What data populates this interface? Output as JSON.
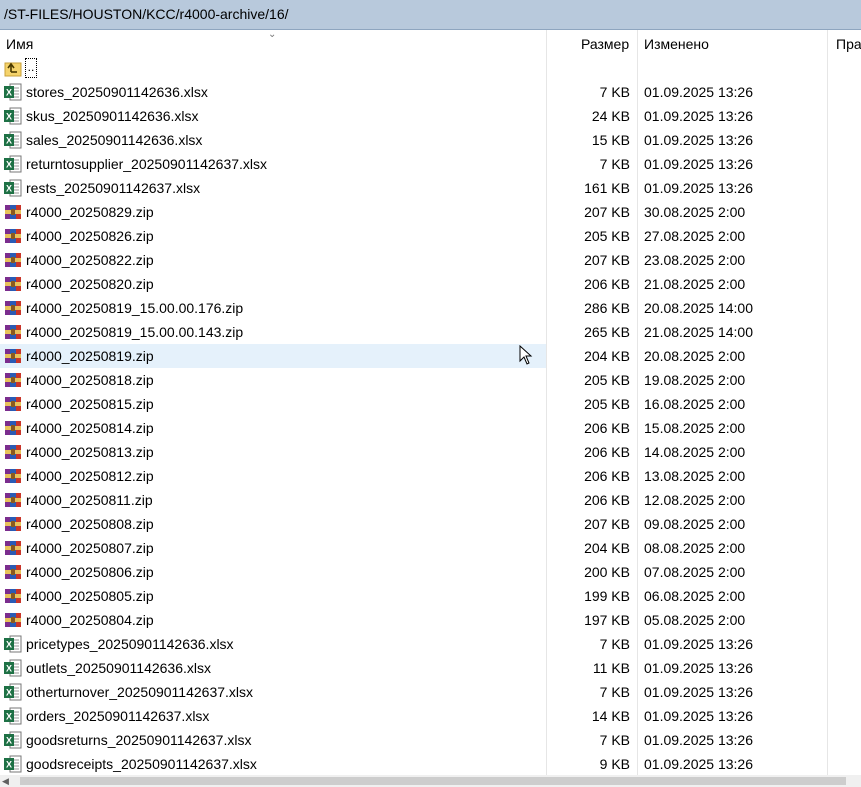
{
  "path": "/ST-FILES/HOUSTON/KCC/r4000-archive/16/",
  "columns": {
    "name": "Имя",
    "size": "Размер",
    "modified": "Изменено",
    "rights": "Пра"
  },
  "parent_label": "..",
  "files": [
    {
      "name": "stores_20250901142636.xlsx",
      "size": "7 KB",
      "date": "01.09.2025 13:26",
      "type": "xlsx"
    },
    {
      "name": "skus_20250901142636.xlsx",
      "size": "24 KB",
      "date": "01.09.2025 13:26",
      "type": "xlsx"
    },
    {
      "name": "sales_20250901142636.xlsx",
      "size": "15 KB",
      "date": "01.09.2025 13:26",
      "type": "xlsx"
    },
    {
      "name": "returntosupplier_20250901142637.xlsx",
      "size": "7 KB",
      "date": "01.09.2025 13:26",
      "type": "xlsx"
    },
    {
      "name": "rests_20250901142637.xlsx",
      "size": "161 KB",
      "date": "01.09.2025 13:26",
      "type": "xlsx"
    },
    {
      "name": "r4000_20250829.zip",
      "size": "207 KB",
      "date": "30.08.2025 2:00",
      "type": "zip"
    },
    {
      "name": "r4000_20250826.zip",
      "size": "205 KB",
      "date": "27.08.2025 2:00",
      "type": "zip"
    },
    {
      "name": "r4000_20250822.zip",
      "size": "207 KB",
      "date": "23.08.2025 2:00",
      "type": "zip"
    },
    {
      "name": "r4000_20250820.zip",
      "size": "206 KB",
      "date": "21.08.2025 2:00",
      "type": "zip"
    },
    {
      "name": "r4000_20250819_15.00.00.176.zip",
      "size": "286 KB",
      "date": "20.08.2025 14:00",
      "type": "zip"
    },
    {
      "name": "r4000_20250819_15.00.00.143.zip",
      "size": "265 KB",
      "date": "21.08.2025 14:00",
      "type": "zip"
    },
    {
      "name": "r4000_20250819.zip",
      "size": "204 KB",
      "date": "20.08.2025 2:00",
      "type": "zip",
      "hover": true
    },
    {
      "name": "r4000_20250818.zip",
      "size": "205 KB",
      "date": "19.08.2025 2:00",
      "type": "zip"
    },
    {
      "name": "r4000_20250815.zip",
      "size": "205 KB",
      "date": "16.08.2025 2:00",
      "type": "zip"
    },
    {
      "name": "r4000_20250814.zip",
      "size": "206 KB",
      "date": "15.08.2025 2:00",
      "type": "zip"
    },
    {
      "name": "r4000_20250813.zip",
      "size": "206 KB",
      "date": "14.08.2025 2:00",
      "type": "zip"
    },
    {
      "name": "r4000_20250812.zip",
      "size": "206 KB",
      "date": "13.08.2025 2:00",
      "type": "zip"
    },
    {
      "name": "r4000_20250811.zip",
      "size": "206 KB",
      "date": "12.08.2025 2:00",
      "type": "zip"
    },
    {
      "name": "r4000_20250808.zip",
      "size": "207 KB",
      "date": "09.08.2025 2:00",
      "type": "zip"
    },
    {
      "name": "r4000_20250807.zip",
      "size": "204 KB",
      "date": "08.08.2025 2:00",
      "type": "zip"
    },
    {
      "name": "r4000_20250806.zip",
      "size": "200 KB",
      "date": "07.08.2025 2:00",
      "type": "zip"
    },
    {
      "name": "r4000_20250805.zip",
      "size": "199 KB",
      "date": "06.08.2025 2:00",
      "type": "zip"
    },
    {
      "name": "r4000_20250804.zip",
      "size": "197 KB",
      "date": "05.08.2025 2:00",
      "type": "zip"
    },
    {
      "name": "pricetypes_20250901142636.xlsx",
      "size": "7 KB",
      "date": "01.09.2025 13:26",
      "type": "xlsx"
    },
    {
      "name": "outlets_20250901142636.xlsx",
      "size": "11 KB",
      "date": "01.09.2025 13:26",
      "type": "xlsx"
    },
    {
      "name": "otherturnover_20250901142637.xlsx",
      "size": "7 KB",
      "date": "01.09.2025 13:26",
      "type": "xlsx"
    },
    {
      "name": "orders_20250901142637.xlsx",
      "size": "14 KB",
      "date": "01.09.2025 13:26",
      "type": "xlsx"
    },
    {
      "name": "goodsreturns_20250901142637.xlsx",
      "size": "7 KB",
      "date": "01.09.2025 13:26",
      "type": "xlsx"
    },
    {
      "name": "goodsreceipts_20250901142637.xlsx",
      "size": "9 KB",
      "date": "01.09.2025 13:26",
      "type": "xlsx"
    }
  ],
  "icons": {
    "xlsx": "excel-file-icon",
    "zip": "winrar-archive-icon",
    "parent": "parent-folder-icon",
    "sort": "sort-down-icon"
  },
  "colors": {
    "path_bg": "#b8c9dc",
    "hover_bg": "#e5f1fb",
    "excel_green": "#1e7145"
  }
}
